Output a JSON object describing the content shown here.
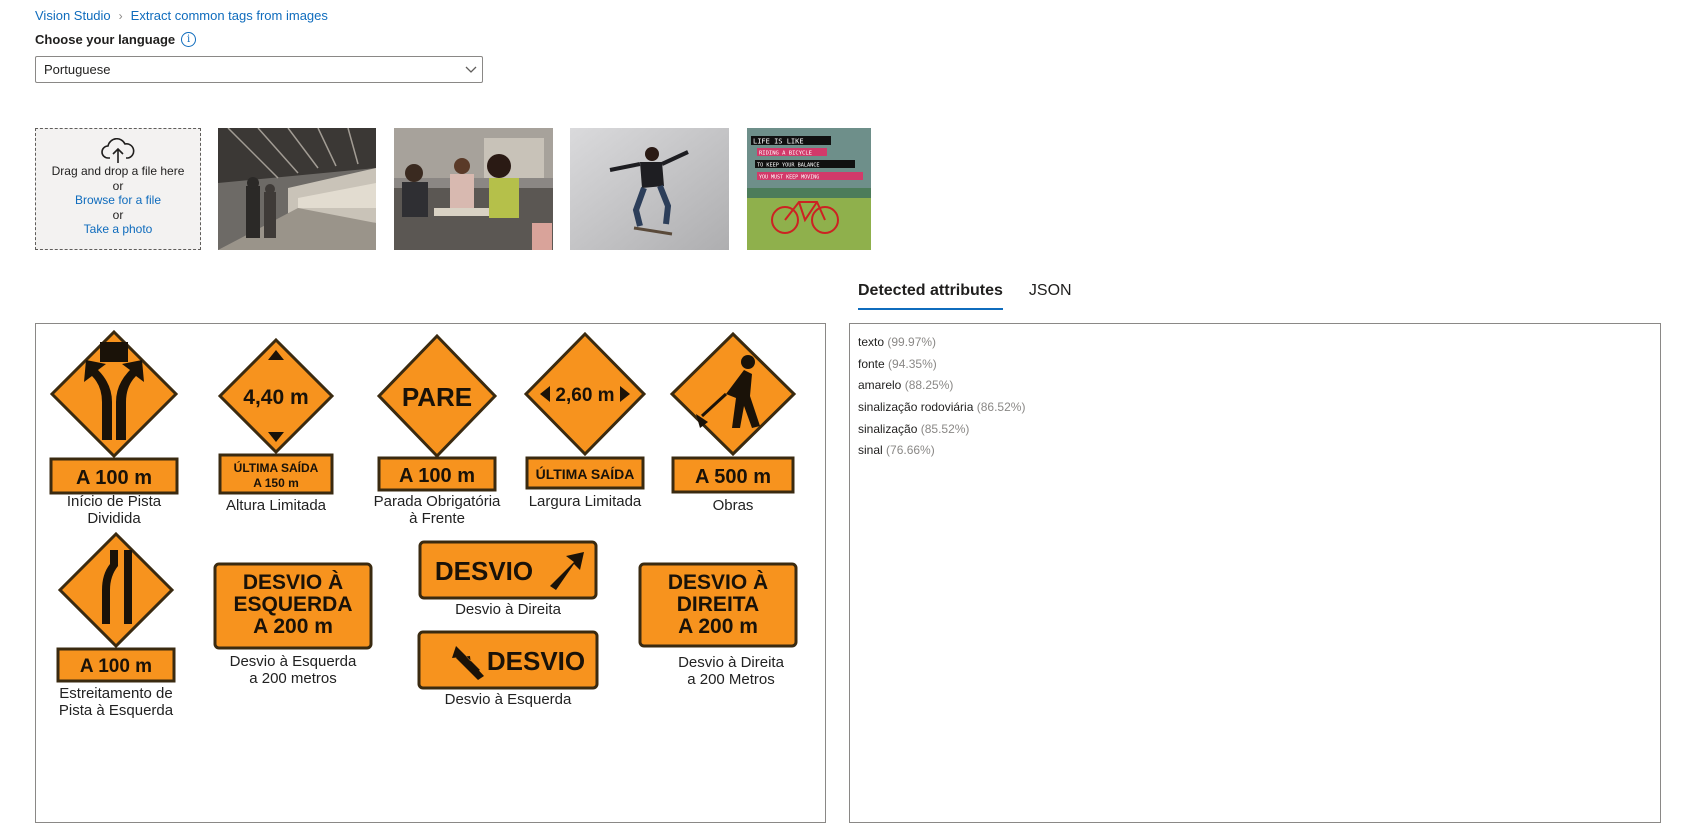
{
  "breadcrumb": {
    "root": "Vision Studio",
    "current": "Extract common tags from images"
  },
  "language": {
    "label": "Choose your language",
    "selected": "Portuguese"
  },
  "upload": {
    "drag_text": "Drag and drop a file here",
    "or1": "or",
    "browse": "Browse for a file",
    "or2": "or",
    "photo": "Take a photo"
  },
  "tabs": [
    "Detected attributes",
    "JSON"
  ],
  "attributes": [
    {
      "name": "texto",
      "confidence": "(99.97%)"
    },
    {
      "name": "fonte",
      "confidence": "(94.35%)"
    },
    {
      "name": "amarelo",
      "confidence": "(88.25%)"
    },
    {
      "name": "sinalização rodoviária",
      "confidence": "(86.52%)"
    },
    {
      "name": "sinalização",
      "confidence": "(85.52%)"
    },
    {
      "name": "sinal",
      "confidence": "(76.66%)"
    }
  ],
  "thumb4_text": [
    "LIFE IS LIKE",
    "RIDING A BICYCLE",
    "TO KEEP YOUR BALANCE",
    "YOU MUST KEEP MOVING"
  ],
  "signs": {
    "s1_plate": "A 100 m",
    "s1_caption_1": "Início de Pista",
    "s1_caption_2": "Dividida",
    "s2_main": "4,40 m",
    "s2_plate_1": "ÚLTIMA SAÍDA",
    "s2_plate_2": "A 150 m",
    "s2_caption": "Altura Limitada",
    "s3_main": "PARE",
    "s3_plate": "A 100 m",
    "s3_caption_1": "Parada Obrigatória",
    "s3_caption_2": "à Frente",
    "s4_main": "2,60 m",
    "s4_plate": "ÚLTIMA SAÍDA",
    "s4_caption": "Largura Limitada",
    "s5_plate": "A 500 m",
    "s5_caption": "Obras",
    "s6_plate": "A 100 m",
    "s6_caption_1": "Estreitamento de",
    "s6_caption_2": "Pista à Esquerda",
    "s7_line_1": "DESVIO À",
    "s7_line_2": "ESQUERDA",
    "s7_line_3": "A 200 m",
    "s7_caption_1": "Desvio à Esquerda",
    "s7_caption_2": "a 200 metros",
    "s8_main": "DESVIO",
    "s8_caption": "Desvio à Direita",
    "s9_main": "DESVIO",
    "s9_caption": "Desvio à Esquerda",
    "s10_line_1": "DESVIO À",
    "s10_line_2": "DIREITA",
    "s10_line_3": "A 200 m",
    "s10_caption_1": "Desvio à Direita",
    "s10_caption_2": "a 200 Metros"
  },
  "colors": {
    "accent": "#0f6cbd",
    "sign_orange": "#f7931e",
    "sign_border": "#3a2a10"
  }
}
